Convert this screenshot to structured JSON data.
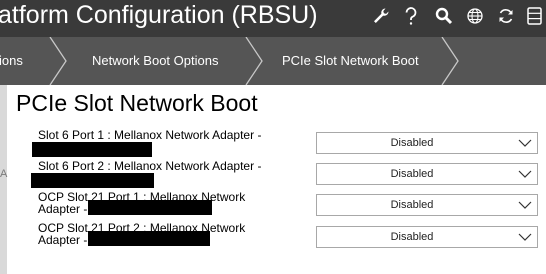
{
  "header": {
    "title": "atform Configuration (RBSU)",
    "icons": [
      "wrench-icon",
      "help-icon",
      "search-icon",
      "globe-icon",
      "refresh-icon",
      "storage-icon"
    ]
  },
  "breadcrumb": {
    "items": [
      {
        "label": "ions"
      },
      {
        "label": "Network Boot Options"
      },
      {
        "label": "PCIe Slot Network Boot"
      }
    ]
  },
  "sidebar": {
    "letter": "A"
  },
  "page": {
    "title": "PCIe Slot Network Boot",
    "options": [
      {
        "line1": "Slot 6 Port 1 : Mellanox Network Adapter -",
        "line2": "",
        "value": "Disabled"
      },
      {
        "line1": "Slot 6 Port 2 : Mellanox Network Adapter -",
        "line2": "",
        "value": "Disabled"
      },
      {
        "line1": "OCP Slot 21 Port 1 : Mellanox Network",
        "line2": "Adapter -",
        "value": "Disabled"
      },
      {
        "line1": "OCP Slot 21 Port 2 : Mellanox Network",
        "line2": "Adapter -",
        "value": "Disabled"
      }
    ]
  },
  "colors": {
    "header_bg": "#3a3a3a",
    "breadcrumb_bg": "#555555",
    "text": "#000000"
  }
}
